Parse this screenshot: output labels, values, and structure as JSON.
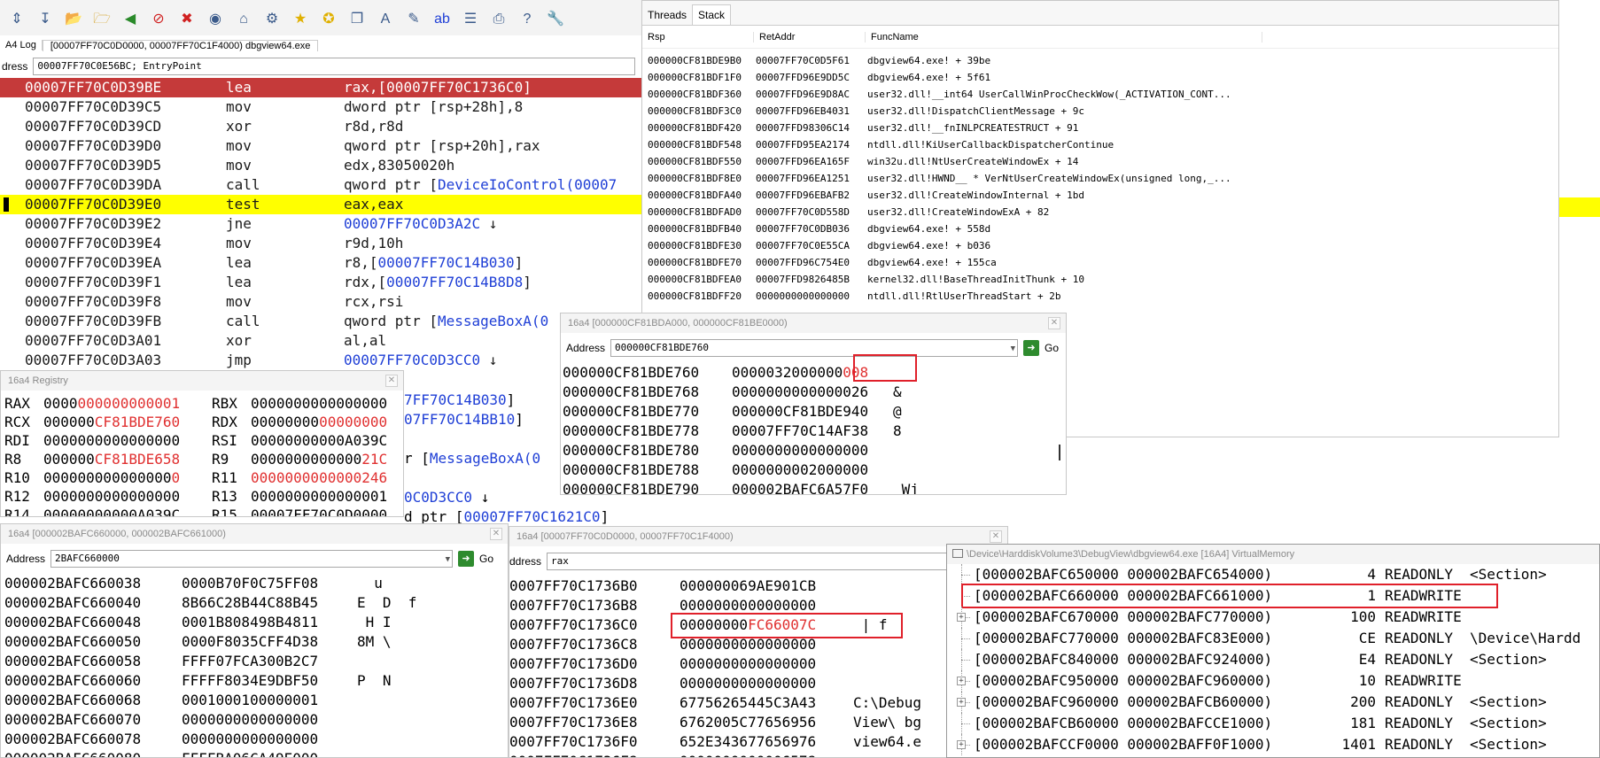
{
  "toolbar": {
    "icons": [
      "step-icon",
      "step-over-icon",
      "open-icon",
      "open-folder-icon",
      "back-icon",
      "stop-icon",
      "close-icon",
      "breakpoint-icon",
      "home-icon",
      "thread-icon",
      "star-icon",
      "star-add-icon",
      "copy-icon",
      "font-icon",
      "highlight-icon",
      "abc-icon",
      "list-icon",
      "print-icon",
      "help-icon",
      "wrench-icon"
    ]
  },
  "main": {
    "tab_left": "A4 Log",
    "tab_title": "[00007FF70C0D0000, 00007FF70C1F4000) dbgview64.exe",
    "address_label": "dress",
    "address_value": "00007FF70C0E56BC; EntryPoint",
    "disasm": [
      {
        "addr": "00007FF70C0D39BE",
        "mn": "lea",
        "pre": "rax,[",
        "link": "00007FF70C1736C0",
        "post": "]",
        "style": "current"
      },
      {
        "addr": "00007FF70C0D39C5",
        "mn": "mov",
        "pre": "dword ptr [rsp+28h],8",
        "link": "",
        "post": "",
        "style": ""
      },
      {
        "addr": "00007FF70C0D39CD",
        "mn": "xor",
        "pre": "r8d,r8d",
        "link": "",
        "post": "",
        "style": ""
      },
      {
        "addr": "00007FF70C0D39D0",
        "mn": "mov",
        "pre": "qword ptr [rsp+20h],rax",
        "link": "",
        "post": "",
        "style": ""
      },
      {
        "addr": "00007FF70C0D39D5",
        "mn": "mov",
        "pre": "edx,83050020h",
        "link": "",
        "post": "",
        "style": ""
      },
      {
        "addr": "00007FF70C0D39DA",
        "mn": "call",
        "pre": "qword ptr [",
        "link": "DeviceIoControl(00007",
        "post": "",
        "style": ""
      },
      {
        "addr": "00007FF70C0D39E0",
        "mn": "test",
        "pre": "eax,eax",
        "link": "",
        "post": "",
        "style": "highlight"
      },
      {
        "addr": "00007FF70C0D39E2",
        "mn": "jne",
        "pre": "",
        "link": "00007FF70C0D3A2C",
        "post": " ↓",
        "style": ""
      },
      {
        "addr": "00007FF70C0D39E4",
        "mn": "mov",
        "pre": "r9d,10h",
        "link": "",
        "post": "",
        "style": ""
      },
      {
        "addr": "00007FF70C0D39EA",
        "mn": "lea",
        "pre": "r8,[",
        "link": "00007FF70C14B030",
        "post": "]",
        "style": ""
      },
      {
        "addr": "00007FF70C0D39F1",
        "mn": "lea",
        "pre": "rdx,[",
        "link": "00007FF70C14B8D8",
        "post": "]",
        "style": ""
      },
      {
        "addr": "00007FF70C0D39F8",
        "mn": "mov",
        "pre": "rcx,rsi",
        "link": "",
        "post": "",
        "style": ""
      },
      {
        "addr": "00007FF70C0D39FB",
        "mn": "call",
        "pre": "qword ptr [",
        "link": "MessageBoxA(0",
        "post": "",
        "style": ""
      },
      {
        "addr": "00007FF70C0D3A01",
        "mn": "xor",
        "pre": "al,al",
        "link": "",
        "post": "",
        "style": ""
      },
      {
        "addr": "00007FF70C0D3A03",
        "mn": "jmp",
        "pre": "",
        "link": "00007FF70C0D3CC0",
        "post": " ↓",
        "style": ""
      }
    ],
    "peek_lines": [
      {
        "pre": "",
        "link": "7FF70C14B030",
        "post": "]"
      },
      {
        "pre": "",
        "link": "07FF70C14BB10",
        "post": "]"
      },
      {
        "pre": "",
        "link": "",
        "post": ""
      },
      {
        "pre": "r [",
        "link": "MessageBoxA(0",
        "post": ""
      },
      {
        "pre": "",
        "link": "",
        "post": ""
      },
      {
        "pre": "",
        "link": "0C0D3CC0",
        "post": " ↓"
      },
      {
        "pre": "d ptr [",
        "link": "00007FF70C1621C0",
        "post": "]"
      }
    ]
  },
  "stack_window": {
    "tabs": [
      "Threads",
      "Stack"
    ],
    "active_tab": "Stack",
    "columns": [
      "Rsp",
      "RetAddr",
      "FuncName"
    ],
    "rows": [
      [
        "000000CF81BDE9B0",
        "00007FF70C0D5F61",
        "dbgview64.exe! + 39be"
      ],
      [
        "000000CF81BDF1F0",
        "00007FFD96E9DD5C",
        "dbgview64.exe! + 5f61"
      ],
      [
        "000000CF81BDF360",
        "00007FFD96E9D8AC",
        "user32.dll!__int64 UserCallWinProcCheckWow(_ACTIVATION_CONT..."
      ],
      [
        "000000CF81BDF3C0",
        "00007FFD96EB4031",
        "user32.dll!DispatchClientMessage + 9c"
      ],
      [
        "000000CF81BDF420",
        "00007FFD98306C14",
        "user32.dll!__fnINLPCREATESTRUCT + 91"
      ],
      [
        "000000CF81BDF548",
        "00007FFD95EA2174",
        "ntdll.dll!KiUserCallbackDispatcherContinue"
      ],
      [
        "000000CF81BDF550",
        "00007FFD96EA165F",
        "win32u.dll!NtUserCreateWindowEx + 14"
      ],
      [
        "000000CF81BDF8E0",
        "00007FFD96EA1251",
        "user32.dll!HWND__ * VerNtUserCreateWindowEx(unsigned long,_..."
      ],
      [
        "000000CF81BDFA40",
        "00007FFD96EBAFB2",
        "user32.dll!CreateWindowInternal + 1bd"
      ],
      [
        "000000CF81BDFAD0",
        "00007FF70C0D558D",
        "user32.dll!CreateWindowExA + 82"
      ],
      [
        "000000CF81BDFB40",
        "00007FF70C0DB036",
        "dbgview64.exe! + 558d"
      ],
      [
        "000000CF81BDFE30",
        "00007FF70C0E55CA",
        "dbgview64.exe! + b036"
      ],
      [
        "000000CF81BDFE70",
        "00007FFD96C754E0",
        "dbgview64.exe! + 155ca"
      ],
      [
        "000000CF81BDFEA0",
        "00007FFD9826485B",
        "kernel32.dll!BaseThreadInitThunk + 10"
      ],
      [
        "000000CF81BDFF20",
        "0000000000000000",
        "ntdll.dll!RtlUserThreadStart + 2b"
      ]
    ]
  },
  "registry": {
    "title": "16a4 Registry",
    "rows": [
      {
        "l": "RAX",
        "lv": [
          "0000",
          "0000",
          "0000000",
          "1"
        ],
        "lc": [
          "n",
          "r",
          "r",
          "r"
        ],
        "r": "RBX",
        "rv": [
          "000000000000000",
          "0"
        ],
        "rc": [
          "n",
          "n"
        ]
      },
      {
        "l": "RCX",
        "lv": [
          "000000",
          "CF81BDE760"
        ],
        "lc": [
          "n",
          "r"
        ],
        "r": "RDX",
        "rv": [
          "00000000",
          "00000000"
        ],
        "rc": [
          "n",
          "r"
        ]
      },
      {
        "l": "RDI",
        "lv": [
          "0000000000000000"
        ],
        "lc": [
          "n"
        ],
        "r": "RSI",
        "rv": [
          "00000000000A039C"
        ],
        "rc": [
          "n"
        ]
      },
      {
        "l": "R8",
        "lv": [
          "000000",
          "CF81BDE658"
        ],
        "lc": [
          "n",
          "r"
        ],
        "r": "R9",
        "rv": [
          "0000000000000",
          "21C"
        ],
        "rc": [
          "n",
          "r"
        ]
      },
      {
        "l": "R10",
        "lv": [
          "000000000000000",
          "0"
        ],
        "lc": [
          "n",
          "r"
        ],
        "r": "R11",
        "rv": [
          "0000000000000246"
        ],
        "rc": [
          "r"
        ]
      },
      {
        "l": "R12",
        "lv": [
          "0000000000000000"
        ],
        "lc": [
          "n"
        ],
        "r": "R13",
        "rv": [
          "0000000000000001"
        ],
        "rc": [
          "n"
        ]
      },
      {
        "l": "R14",
        "lv": [
          "00000000000A039C"
        ],
        "lc": [
          "n"
        ],
        "r": "R15",
        "rv": [
          "00007FF70C0D0000"
        ],
        "rc": [
          "n"
        ]
      },
      {
        "l": "RBP",
        "lv": [
          "000000CF81BDEAB0"
        ],
        "lc": [
          "n"
        ],
        "r": "RSP",
        "rv": [
          "000000CF81BDE720"
        ],
        "rc": [
          "n"
        ]
      }
    ]
  },
  "mem1": {
    "title": "16a4 [000000CF81BDA000, 000000CF81BE0000)",
    "address_label": "Address",
    "address_value": "000000CF81BDE760",
    "go_label": "Go",
    "rows": [
      {
        "addr": "000000CF81BDE760",
        "val": "0000032000000",
        "valr": "008",
        "asc": ""
      },
      {
        "addr": "000000CF81BDE768",
        "val": "0000000000000026",
        "valr": "",
        "asc": "&"
      },
      {
        "addr": "000000CF81BDE770",
        "val": "000000CF81BDE940",
        "valr": "",
        "asc": "@"
      },
      {
        "addr": "000000CF81BDE778",
        "val": "00007FF70C14AF38",
        "valr": "",
        "asc": "8"
      },
      {
        "addr": "000000CF81BDE780",
        "val": "0000000000000000",
        "valr": "",
        "asc": ""
      },
      {
        "addr": "000000CF81BDE788",
        "val": "0000000002000000",
        "valr": "",
        "asc": ""
      },
      {
        "addr": "000000CF81BDE790",
        "val": "000002BAFC6A57F0",
        "valr": "",
        "asc": " Wj"
      }
    ]
  },
  "mem2": {
    "title": "16a4 [000002BAFC660000, 000002BAFC661000)",
    "address_label": "Address",
    "address_value": "2BAFC660000",
    "go_label": "Go",
    "rows": [
      {
        "addr": "000002BAFC660038",
        "val": "0000B70F0C75FF08",
        "asc": "  u"
      },
      {
        "addr": "000002BAFC660040",
        "val": "8B66C28B44C88B45",
        "asc": "E  D  f"
      },
      {
        "addr": "000002BAFC660048",
        "val": "0001B808498B4811",
        "asc": " H I"
      },
      {
        "addr": "000002BAFC660050",
        "val": "0000F8035CFF4D38",
        "asc": "8M \\"
      },
      {
        "addr": "000002BAFC660058",
        "val": "FFFF07FCA300B2C7",
        "asc": ""
      },
      {
        "addr": "000002BAFC660060",
        "val": "FFFFF8034E9DBF50",
        "asc": "P  N"
      },
      {
        "addr": "000002BAFC660068",
        "val": "0001000100000001",
        "asc": ""
      },
      {
        "addr": "000002BAFC660070",
        "val": "0000000000000000",
        "asc": ""
      },
      {
        "addr": "000002BAFC660078",
        "val": "0000000000000000",
        "asc": ""
      },
      {
        "addr": "000002BAFC660080",
        "val": "FFFFBA06CA49E000",
        "asc": ""
      }
    ]
  },
  "mem3": {
    "title": "16a4 [00007FF70C0D0000, 00007FF70C1F4000)",
    "address_label": "ddress",
    "address_value": "rax",
    "rows": [
      {
        "addr": "0007FF70C1736B0",
        "val": "000000069AE901CB",
        "valr": "",
        "asc": ""
      },
      {
        "addr": "0007FF70C1736B8",
        "val": "0000000000000000",
        "valr": "",
        "asc": ""
      },
      {
        "addr": "0007FF70C1736C0",
        "val": "00000000",
        "valr": "FC66007C",
        "asc": " | f"
      },
      {
        "addr": "0007FF70C1736C8",
        "val": "0000000000000000",
        "valr": "",
        "asc": ""
      },
      {
        "addr": "0007FF70C1736D0",
        "val": "0000000000000000",
        "valr": "",
        "asc": ""
      },
      {
        "addr": "0007FF70C1736D8",
        "val": "0000000000000000",
        "valr": "",
        "asc": ""
      },
      {
        "addr": "0007FF70C1736E0",
        "val": "67756265445C3A43",
        "valr": "",
        "asc": "C:\\Debug"
      },
      {
        "addr": "0007FF70C1736E8",
        "val": "6762005C77656956",
        "valr": "",
        "asc": "View\\ bg"
      },
      {
        "addr": "0007FF70C1736F0",
        "val": "652E343677656976",
        "valr": "",
        "asc": "view64.e"
      },
      {
        "addr": "0007FF70C1736F8",
        "val": "0000000000006578",
        "valr": "",
        "asc": ""
      }
    ]
  },
  "vmem": {
    "title": "\\Device\\HarddiskVolume3\\DebugView\\dbgview64.exe [16A4] VirtualMemory",
    "rows": [
      {
        "range": "[000002BAFC650000 000002BAFC654000)",
        "size": "4",
        "prot": "READONLY",
        "name": "<Section>",
        "exp": false
      },
      {
        "range": "[000002BAFC660000 000002BAFC661000)",
        "size": "1",
        "prot": "READWRITE",
        "name": "",
        "exp": false
      },
      {
        "range": "[000002BAFC670000 000002BAFC770000)",
        "size": "100",
        "prot": "READWRITE",
        "name": "",
        "exp": true
      },
      {
        "range": "[000002BAFC770000 000002BAFC83E000)",
        "size": "CE",
        "prot": "READONLY",
        "name": "\\Device\\Hardd",
        "exp": false
      },
      {
        "range": "[000002BAFC840000 000002BAFC924000)",
        "size": "E4",
        "prot": "READONLY",
        "name": "<Section>",
        "exp": false
      },
      {
        "range": "[000002BAFC950000 000002BAFC960000)",
        "size": "10",
        "prot": "READWRITE",
        "name": "",
        "exp": true
      },
      {
        "range": "[000002BAFC960000 000002BAFCB60000)",
        "size": "200",
        "prot": "READONLY",
        "name": "<Section>",
        "exp": true
      },
      {
        "range": "[000002BAFCB60000 000002BAFCCE1000)",
        "size": "181",
        "prot": "READONLY",
        "name": "<Section>",
        "exp": false
      },
      {
        "range": "[000002BAFCCF0000 000002BAFF0F1000)",
        "size": "1401",
        "prot": "READONLY",
        "name": "<Section>",
        "exp": true
      }
    ]
  },
  "colors": {
    "accent_red": "#e0202a",
    "current_line": "#c53a3a",
    "highlight": "#ffff00",
    "link": "#1f3fd6"
  }
}
